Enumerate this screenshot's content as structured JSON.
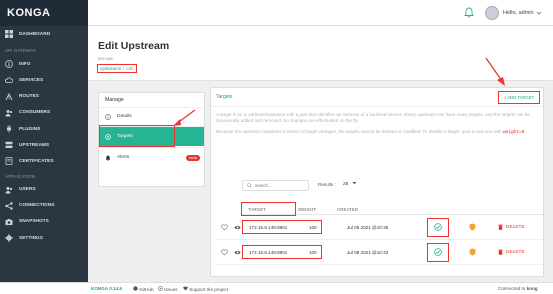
{
  "app": {
    "brand": "KONGA"
  },
  "topbar": {
    "user_label": "Hello, admin"
  },
  "sidebar": {
    "groups": [
      {
        "label": "",
        "items": [
          {
            "label": "DASHBOARD",
            "icon": "dashboard-icon"
          }
        ]
      },
      {
        "label": "API GATEWAY",
        "items": [
          {
            "label": "INFO",
            "icon": "info-icon"
          },
          {
            "label": "SERVICES",
            "icon": "cloud-icon"
          },
          {
            "label": "ROUTES",
            "icon": "routes-icon"
          },
          {
            "label": "CONSUMERS",
            "icon": "users-icon"
          },
          {
            "label": "PLUGINS",
            "icon": "plug-icon"
          },
          {
            "label": "UPSTREAMS",
            "icon": "upstreams-icon"
          },
          {
            "label": "CERTIFICATES",
            "icon": "certificate-icon"
          }
        ]
      },
      {
        "label": "APPLICATION",
        "items": [
          {
            "label": "USERS",
            "icon": "users-icon"
          },
          {
            "label": "CONNECTIONS",
            "icon": "connections-icon"
          },
          {
            "label": "SNAPSHOTS",
            "icon": "camera-icon"
          },
          {
            "label": "SETTINGS",
            "icon": "gear-icon"
          }
        ]
      }
    ]
  },
  "page": {
    "title": "Edit Upstream",
    "subtitle": "pve-ups",
    "breadcrumb": {
      "link": "upstreams",
      "current": "edit"
    }
  },
  "manage": {
    "title": "Manage",
    "items": [
      {
        "label": "Details",
        "icon": "info-circle-icon"
      },
      {
        "label": "Targets",
        "icon": "crosshair-icon"
      },
      {
        "label": "Alerts",
        "icon": "bell-icon",
        "badge": "beta"
      }
    ]
  },
  "targets": {
    "title": "Targets",
    "add_label": "+ ADD TARGET",
    "desc1": "A target is an ip address/hostname with a port that identifies an instance of a backend service. Every upstream can have many targets, and the targets can be dynamically added and removed. So changes are effectuated on the fly.",
    "desc2_pre": "Because the upstream maintains a history of target changes, the targets cannot be deleted or modified. To disable a target, post a new one with",
    "desc2_code": "weight=0",
    "desc2_post": ".",
    "search_placeholder": "search...",
    "results_label": "Results :",
    "results_value": "25",
    "columns": {
      "target": "TARGET",
      "weight": "WEIGHT",
      "created": "CREATED"
    },
    "delete_label": "DELETE",
    "rows": [
      {
        "target": "172.16.6.146:8801",
        "weight": "100",
        "created": "Jul 08 2021 @10:36"
      },
      {
        "target": "172.16.6.146:8901",
        "weight": "100",
        "created": "Jul 08 2021 @10:33"
      }
    ]
  },
  "footer": {
    "version": "KONGA 0.14.9",
    "github": "GitHub",
    "issues": "Issues",
    "support": "Support the project",
    "connected_prefix": "Connected to",
    "connected_to": "kong"
  },
  "colors": {
    "accent": "#25b595",
    "sidebar": "#2b3643",
    "danger": "#e3342f",
    "highlight": "#e33333"
  }
}
